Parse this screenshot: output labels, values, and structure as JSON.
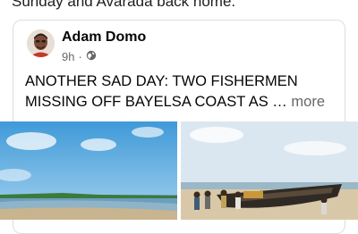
{
  "header": {
    "intro_text": "Sunday and Avarada back home."
  },
  "post": {
    "author": "Adam Domo",
    "time": "9h",
    "separator": "·",
    "audience_icon": "globe-icon",
    "text": "ANOTHER SAD DAY: TWO FISHERMEN MISSING OFF BAYELSA COAST AS …",
    "more_label": "more"
  },
  "photos": [
    {
      "name": "beach-shoreline-photo"
    },
    {
      "name": "fishermen-pushing-boat-photo"
    }
  ],
  "colors": {
    "secondary_text": "#65676b",
    "border": "#dadde1"
  }
}
